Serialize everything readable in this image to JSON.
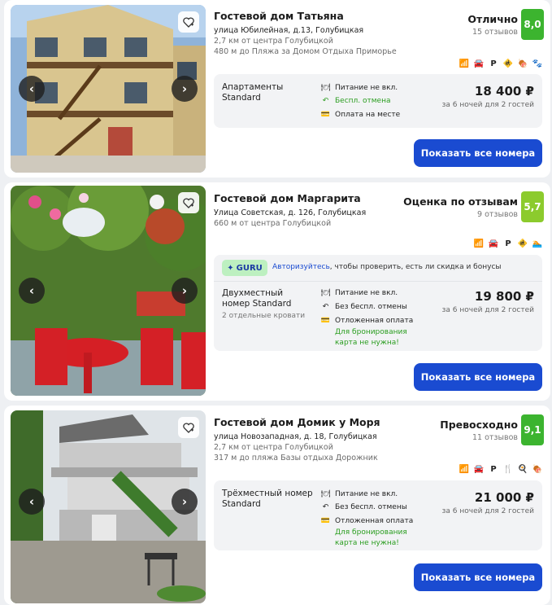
{
  "listings": [
    {
      "name": "Гостевой дом Татьяна",
      "address": "улица Юбилейная, д.13, Голубицкая",
      "distance_center": "2,7 км от центра Голубицкой",
      "distance_beach": "480 м до Пляжа за Домом Отдыха Приморье",
      "rating_label": "Отлично",
      "reviews": "15 отзывов",
      "score": "8,0",
      "room_line1": "Апартаменты",
      "room_line2": "Standard",
      "meal": "Питание не вкл.",
      "cancel": "Беспл. отмена",
      "payment": "Оплата на месте",
      "price": "18 400 ₽",
      "price_note": "за 6 ночей для 2 гостей",
      "button": "Показать все номера",
      "amenities": [
        "wifi-icon",
        "parking-car-icon",
        "parking-p-icon",
        "kids-icon",
        "bbq-icon",
        "pet-icon"
      ]
    },
    {
      "name": "Гостевой дом Маргарита",
      "address": "Улица Советская, д. 126, Голубицкая",
      "distance_center": "660 м от центра Голубицкой",
      "rating_label": "Оценка по отзывам",
      "reviews": "9 отзывов",
      "score": "5,7",
      "guru_label": "GURU",
      "promo_link": "Авторизуйтесь",
      "promo_text": ", чтобы проверить, есть ли скидка и бонусы",
      "room_line1": "Двухместный",
      "room_line2": "номер Standard",
      "room_beds": "2 отдельные кровати",
      "meal": "Питание не вкл.",
      "cancel": "Без беспл. отмены",
      "payment": "Отложенная оплата",
      "card_note1": "Для бронирования",
      "card_note2": "карта не нужна!",
      "price": "19 800 ₽",
      "price_note": "за 6 ночей для 2 гостей",
      "button": "Показать все номера",
      "amenities": [
        "wifi-icon",
        "parking-car-icon",
        "parking-p-icon",
        "kids-icon",
        "pool-icon"
      ]
    },
    {
      "name": "Гостевой дом Домик у Моря",
      "address": "улица Новозападная, д. 18, Голубицкая",
      "distance_center": "2,7 км от центра Голубицкой",
      "distance_beach": "317 м до пляжа Базы отдыха Дорожник",
      "rating_label": "Превосходно",
      "reviews": "11 отзывов",
      "score": "9,1",
      "room_line1": "Трёхместный номер",
      "room_line2": "Standard",
      "meal": "Питание не вкл.",
      "cancel": "Без беспл. отмены",
      "payment": "Отложенная оплата",
      "card_note1": "Для бронирования",
      "card_note2": "карта не нужна!",
      "price": "21 000 ₽",
      "price_note": "за 6 ночей для 2 гостей",
      "button": "Показать все номера",
      "amenities": [
        "wifi-icon",
        "parking-car-icon",
        "parking-p-icon",
        "restaurant-icon",
        "kitchen-icon",
        "bbq-icon"
      ]
    }
  ],
  "colors": {
    "accent": "#1a4bd1",
    "score_high": "#3cb42f",
    "score_mid": "#8ccb2d",
    "green_text": "#2a9d1f"
  }
}
